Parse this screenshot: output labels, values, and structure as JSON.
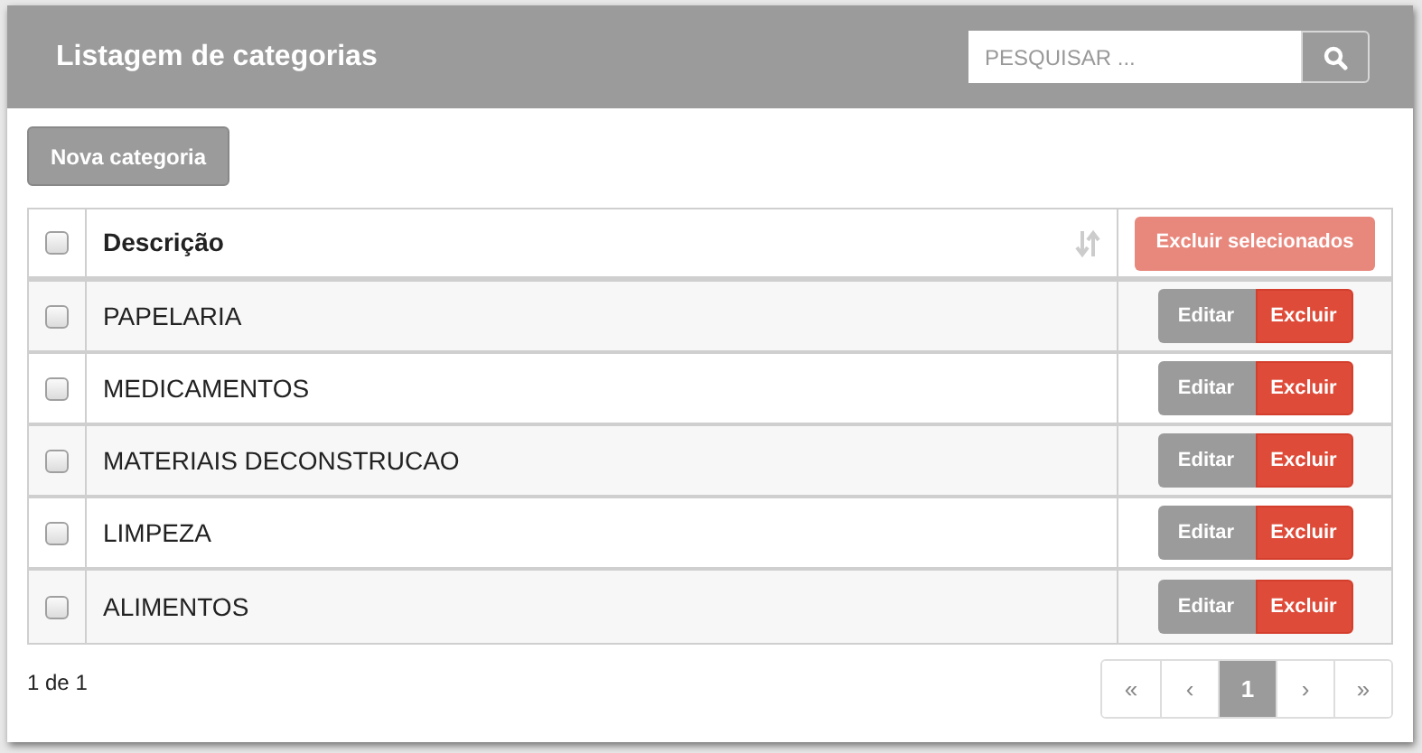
{
  "panel": {
    "title": "Listagem de categorias"
  },
  "search": {
    "placeholder": "PESQUISAR ..."
  },
  "new_button": "Nova categoria",
  "table": {
    "select_all_checked": false,
    "column": "Descrição",
    "bulk_delete": "Excluir selecionados",
    "rows": [
      {
        "name": "PAPELARIA",
        "checked": false,
        "edit": "Editar",
        "delete": "Excluir"
      },
      {
        "name": "MEDICAMENTOS",
        "checked": false,
        "edit": "Editar",
        "delete": "Excluir"
      },
      {
        "name": "MATERIAIS DECONSTRUCAO",
        "checked": false,
        "edit": "Editar",
        "delete": "Excluir"
      },
      {
        "name": "LIMPEZA",
        "checked": false,
        "edit": "Editar",
        "delete": "Excluir"
      },
      {
        "name": "ALIMENTOS",
        "checked": false,
        "edit": "Editar",
        "delete": "Excluir"
      }
    ]
  },
  "page_info": "1 de 1",
  "pagination": [
    {
      "label": "«",
      "selected": false
    },
    {
      "label": "‹",
      "selected": false
    },
    {
      "label": "1",
      "selected": true
    },
    {
      "label": "›",
      "selected": false
    },
    {
      "label": "»",
      "selected": false
    }
  ]
}
